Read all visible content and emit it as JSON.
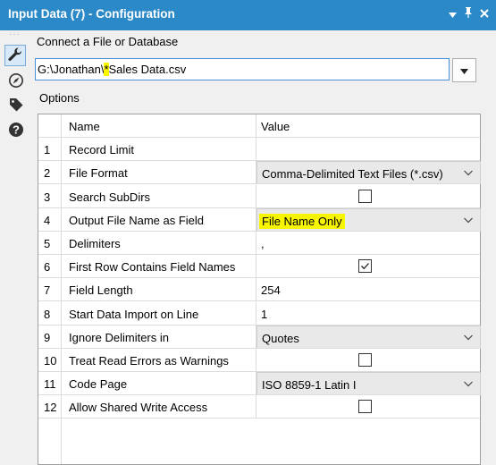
{
  "titlebar": {
    "title": "Input Data (7) - Configuration",
    "menu_icon": "triangle-down",
    "pin_icon": "pin",
    "close_icon": "close"
  },
  "toolbar": {
    "dots": "···",
    "items": [
      {
        "icon": "wrench-icon",
        "active": true
      },
      {
        "icon": "compass-icon",
        "active": false
      },
      {
        "icon": "tag-icon",
        "active": false
      },
      {
        "icon": "question-icon",
        "active": false
      }
    ]
  },
  "connect": {
    "label": "Connect a File or Database",
    "path_prefix": "G:\\Jonathan\\",
    "path_highlight": "*",
    "path_suffix": "Sales Data.csv"
  },
  "options_label": "Options",
  "grid": {
    "header": {
      "name": "Name",
      "value": "Value"
    },
    "rows": [
      {
        "num": "1",
        "name": "Record Limit",
        "type": "text",
        "value": ""
      },
      {
        "num": "2",
        "name": "File Format",
        "type": "dropdown",
        "value": "Comma-Delimited Text Files (*.csv)"
      },
      {
        "num": "3",
        "name": "Search SubDirs",
        "type": "checkbox",
        "checked": false
      },
      {
        "num": "4",
        "name": "Output File Name as Field",
        "type": "dropdown",
        "value": "File Name Only",
        "highlight": true
      },
      {
        "num": "5",
        "name": "Delimiters",
        "type": "text",
        "value": ","
      },
      {
        "num": "6",
        "name": "First Row Contains Field Names",
        "type": "checkbox",
        "checked": true
      },
      {
        "num": "7",
        "name": "Field Length",
        "type": "text",
        "value": "254"
      },
      {
        "num": "8",
        "name": "Start Data Import on Line",
        "type": "text",
        "value": "1"
      },
      {
        "num": "9",
        "name": "Ignore Delimiters in",
        "type": "dropdown",
        "value": "Quotes"
      },
      {
        "num": "10",
        "name": "Treat Read Errors as Warnings",
        "type": "checkbox",
        "checked": false
      },
      {
        "num": "11",
        "name": "Code Page",
        "type": "dropdown",
        "value": "ISO 8859-1 Latin I"
      },
      {
        "num": "12",
        "name": "Allow Shared Write Access",
        "type": "checkbox",
        "checked": false
      }
    ]
  }
}
